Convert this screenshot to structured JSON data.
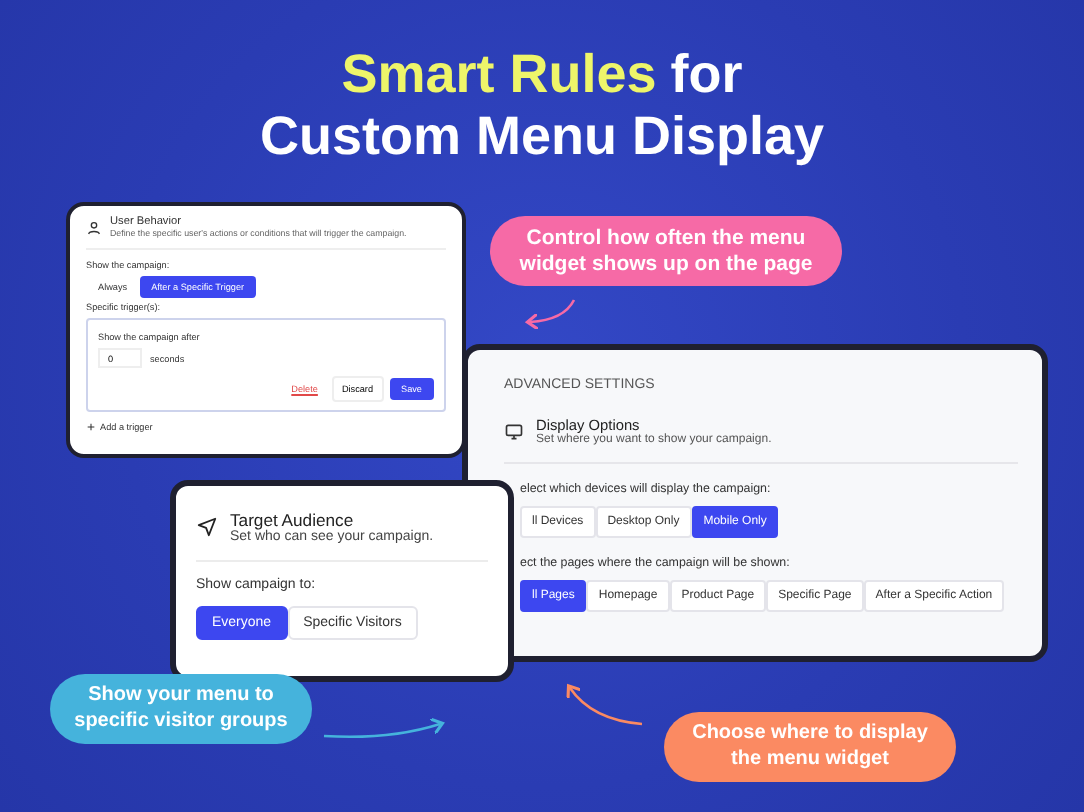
{
  "headline": {
    "lines": [
      [
        {
          "text": "Smart Rules",
          "highlight": true
        },
        {
          "text": "for",
          "highlight": false
        }
      ],
      [
        {
          "text": "Custom Menu Display",
          "highlight": false
        }
      ]
    ]
  },
  "user_behavior": {
    "title": "User Behavior",
    "subtitle": "Define the specific user's actions or conditions that will trigger the campaign.",
    "show_label": "Show the campaign:",
    "options": [
      {
        "label": "Always",
        "selected": false
      },
      {
        "label": "After a Specific Trigger",
        "selected": true
      }
    ],
    "triggers_label": "Specific trigger(s):",
    "trigger": {
      "label": "Show the campaign after",
      "value": "0",
      "unit": "seconds",
      "actions": [
        {
          "label": "Delete",
          "kind": "link"
        },
        {
          "label": "Discard",
          "kind": "secondary"
        },
        {
          "label": "Save",
          "kind": "primary"
        }
      ]
    },
    "add_trigger": "Add a trigger"
  },
  "advanced_settings": {
    "heading": "ADVANCED SETTINGS",
    "title": "Display Options",
    "subtitle": "Set where you want to show your campaign.",
    "devices_label": "elect which devices will display the campaign:",
    "devices": [
      {
        "label": "ll Devices",
        "selected": false
      },
      {
        "label": "Desktop Only",
        "selected": false
      },
      {
        "label": "Mobile Only",
        "selected": true
      }
    ],
    "pages_label": "ect the pages where the campaign will be shown:",
    "pages": [
      {
        "label": "ll Pages",
        "selected": true
      },
      {
        "label": "Homepage",
        "selected": false
      },
      {
        "label": "Product Page",
        "selected": false
      },
      {
        "label": "Specific Page",
        "selected": false
      },
      {
        "label": "After a Specific Action",
        "selected": false
      }
    ]
  },
  "target_audience": {
    "title": "Target Audience",
    "subtitle": "Set who can see your campaign.",
    "show_label": "Show campaign to:",
    "options": [
      {
        "label": "Everyone",
        "selected": true
      },
      {
        "label": "Specific Visitors",
        "selected": false
      }
    ]
  },
  "callouts": [
    {
      "text": "Control how often the menu widget shows up on the page",
      "color": "#f66aa6"
    },
    {
      "text": "Show your menu to specific visitor groups",
      "color": "#45b3dc"
    },
    {
      "text": "Choose where to display the menu widget",
      "color": "#fb8a62"
    }
  ]
}
